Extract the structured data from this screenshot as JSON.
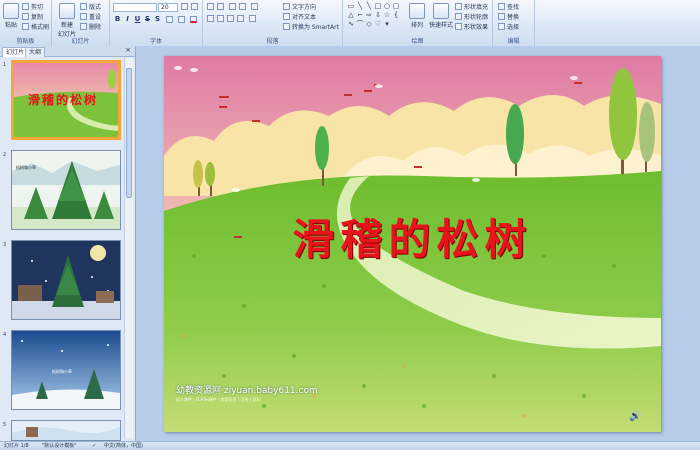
{
  "ribbon": {
    "clipboard": {
      "group_label": "剪贴板",
      "paste": "粘贴",
      "cut": "剪切",
      "copy": "复制",
      "format_painter": "格式刷"
    },
    "slides": {
      "group_label": "幻灯片",
      "new_slide": "新建",
      "new_slide_2": "幻灯片",
      "layout": "版式",
      "reset": "重设",
      "delete": "删除"
    },
    "font": {
      "group_label": "字体",
      "size": "20",
      "bold": "B",
      "italic": "I",
      "underline": "U",
      "strike": "S",
      "shadow": "S"
    },
    "paragraph": {
      "group_label": "段落",
      "text_direction": "文字方向",
      "align_text": "对齐文本",
      "smartart": "转换为 SmartArt"
    },
    "drawing": {
      "group_label": "绘图",
      "arrange": "排列",
      "quick_styles": "快速样式",
      "shape_fill": "形状填充",
      "shape_outline": "形状轮廓",
      "shape_effects": "形状效果"
    },
    "editing": {
      "group_label": "编辑",
      "find": "查找",
      "replace": "替换",
      "select": "选择"
    }
  },
  "left_panel": {
    "tabs": [
      "幻灯片",
      "大纲"
    ],
    "thumbnails": [
      {
        "number": "1",
        "title": "滑稽的松树",
        "selected": true
      },
      {
        "number": "2",
        "title": "松树和小草",
        "selected": false
      },
      {
        "number": "3",
        "title": "",
        "selected": false
      },
      {
        "number": "4",
        "title": "松树和小草",
        "selected": false
      },
      {
        "number": "5",
        "title": "",
        "selected": false
      }
    ]
  },
  "slide": {
    "title": "滑稽的松树",
    "watermark_site": "幼教资源网 ziyuan.baby611.com",
    "watermark_sub": "幼儿课件 | FLASH课件 | 教案反思 | 试卷 | 资料"
  },
  "status": {
    "slide_pos": "幻灯片 1/8",
    "theme": "\"默认设计模板\"",
    "language": "中文(简体，中国)"
  },
  "colors": {
    "title_red": "#e8141c",
    "selected_border": "#f4a63c",
    "ribbon_bg": "#dbe7f6"
  }
}
